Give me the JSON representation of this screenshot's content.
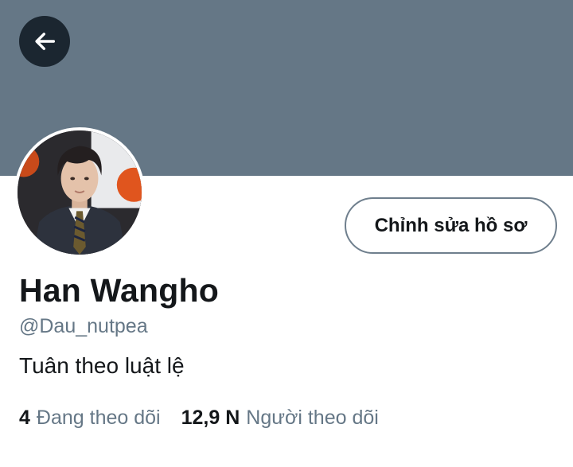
{
  "profile": {
    "name": "Han Wangho",
    "handle": "@Dau_nutpea",
    "bio": "Tuân theo luật lệ",
    "edit_button_label": "Chỉnh sửa hồ sơ"
  },
  "stats": [
    {
      "value": "4",
      "label": "Đang theo dõi"
    },
    {
      "value": "12,9 N",
      "label": "Người theo dõi"
    }
  ],
  "icons": {
    "back": "arrow-left-icon"
  },
  "colors": {
    "banner": "#657786",
    "secondary_text": "#657786",
    "primary_text": "#14171a",
    "back_button_bg": "#1b2630"
  }
}
